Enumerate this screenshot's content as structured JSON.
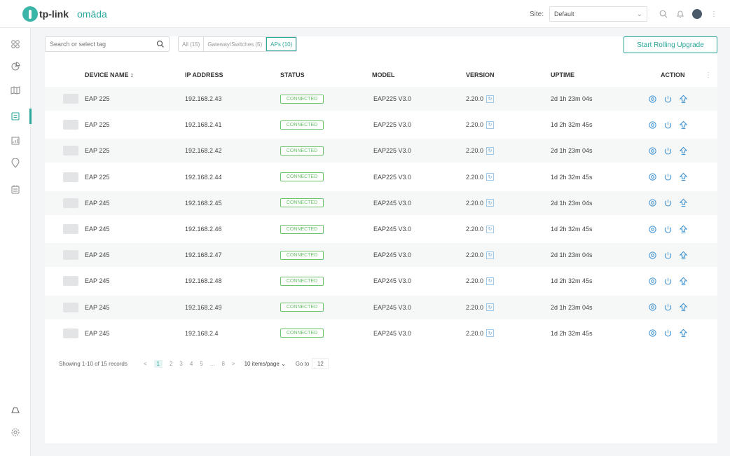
{
  "header": {
    "brand": "tp-link",
    "product": "omāda",
    "site_label": "Site:",
    "site_value": "Default"
  },
  "icons": [
    "search-icon",
    "bell-icon",
    "avatar",
    "more-icon"
  ],
  "sidebar": {
    "items": [
      {
        "name": "dashboard-icon"
      },
      {
        "name": "statistics-icon"
      },
      {
        "name": "map-icon"
      },
      {
        "name": "devices-icon",
        "active": true
      },
      {
        "name": "clients-icon"
      },
      {
        "name": "insight-icon"
      },
      {
        "name": "log-icon"
      },
      {
        "name": "cloud-icon"
      },
      {
        "name": "settings-icon"
      }
    ]
  },
  "toolbar": {
    "search_placeholder": "Search or select tag",
    "segments": [
      "All (15)",
      "Gateway/Switches (5)",
      "APs (10)"
    ],
    "active_segment": 2,
    "rolling_label": "Start Rolling Upgrade"
  },
  "table": {
    "columns": [
      "DEVICE NAME ↕",
      "IP ADDRESS",
      "STATUS",
      "MODEL",
      "VERSION",
      "UPTIME",
      "ACTION"
    ],
    "rows": [
      {
        "name": "EAP 225",
        "ip": "192.168.2.43",
        "status": "CONNECTED",
        "model": "EAP225 V3.0",
        "version": "2.20.0",
        "uptime": "2d 1h 23m 04s"
      },
      {
        "name": "EAP 225",
        "ip": "192.168.2.41",
        "status": "CONNECTED",
        "model": "EAP225 V3.0",
        "version": "2.20.0",
        "uptime": "1d 2h 32m 45s"
      },
      {
        "name": "EAP 225",
        "ip": "192.168.2.42",
        "status": "CONNECTED",
        "model": "EAP225 V3.0",
        "version": "2.20.0",
        "uptime": "2d 1h 23m 04s"
      },
      {
        "name": "EAP 225",
        "ip": "192.168.2.44",
        "status": "CONNECTED",
        "model": "EAP225 V3.0",
        "version": "2.20.0",
        "uptime": "1d 2h 32m 45s"
      },
      {
        "name": "EAP 245",
        "ip": "192.168.2.45",
        "status": "CONNECTED",
        "model": "EAP245 V3.0",
        "version": "2.20.0",
        "uptime": "2d 1h 23m 04s"
      },
      {
        "name": "EAP 245",
        "ip": "192.168.2.46",
        "status": "CONNECTED",
        "model": "EAP245 V3.0",
        "version": "2.20.0",
        "uptime": "1d 2h 32m 45s"
      },
      {
        "name": "EAP 245",
        "ip": "192.168.2.47",
        "status": "CONNECTED",
        "model": "EAP245 V3.0",
        "version": "2.20.0",
        "uptime": "2d 1h 23m 04s"
      },
      {
        "name": "EAP 245",
        "ip": "192.168.2.48",
        "status": "CONNECTED",
        "model": "EAP245 V3.0",
        "version": "2.20.0",
        "uptime": "1d 2h 32m 45s"
      },
      {
        "name": "EAP 245",
        "ip": "192.168.2.49",
        "status": "CONNECTED",
        "model": "EAP245 V3.0",
        "version": "2.20.0",
        "uptime": "2d 1h 23m 04s"
      },
      {
        "name": "EAP 245",
        "ip": "192.168.2.4",
        "status": "CONNECTED",
        "model": "EAP245 V3.0",
        "version": "2.20.0",
        "uptime": "1d 2h 32m 45s"
      }
    ]
  },
  "pagination": {
    "summary": "Showing 1-10 of 15 records",
    "prev": "<",
    "pages": [
      "1",
      "2",
      "3",
      "4",
      "5",
      "...",
      "8"
    ],
    "active_page": "1",
    "next": ">",
    "per_page": "10 items/page",
    "goto_label": "Go to",
    "goto_value": "12"
  },
  "colors": {
    "accent": "#2aa79a",
    "connected": "#6bc26b",
    "action_icon": "#3a8fd0"
  }
}
